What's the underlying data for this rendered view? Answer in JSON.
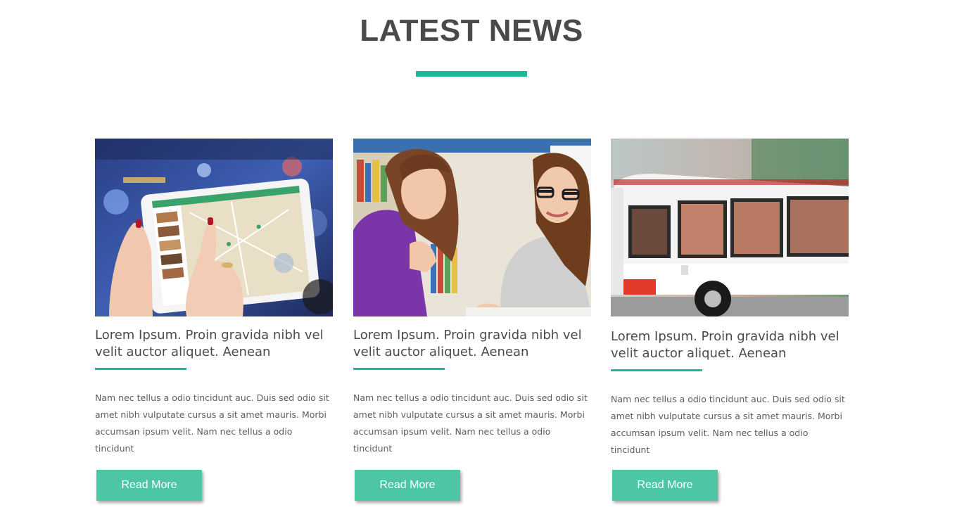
{
  "section": {
    "title": "LATEST NEWS",
    "accent_color": "#1db79a",
    "button_color": "#4cc6a4"
  },
  "posts": [
    {
      "image_icon": "tablet-map-photo",
      "headline": "Lorem Ipsum. Proin gravida nibh vel velit auctor aliquet. Aenean",
      "excerpt": "Nam nec tellus a odio tincidunt auc. Duis sed odio sit amet nibh vulputate cursus a sit amet mauris. Morbi accumsan ipsum velit. Nam nec tellus a odio tincidunt",
      "button_label": "Read More"
    },
    {
      "image_icon": "students-studying-photo",
      "headline": "Lorem Ipsum. Proin gravida nibh vel velit auctor aliquet. Aenean",
      "excerpt": "Nam nec tellus a odio tincidunt auc. Duis sed odio sit amet nibh vulputate cursus a sit amet mauris. Morbi accumsan ipsum velit. Nam nec tellus a odio tincidunt",
      "button_label": "Read More"
    },
    {
      "image_icon": "city-bus-photo",
      "headline": "Lorem Ipsum. Proin gravida nibh vel velit auctor aliquet. Aenean",
      "excerpt": "Nam nec tellus a odio tincidunt auc. Duis sed odio sit amet nibh vulputate cursus a sit amet mauris. Morbi accumsan ipsum velit. Nam nec tellus a odio tincidunt",
      "button_label": "Read More"
    }
  ]
}
